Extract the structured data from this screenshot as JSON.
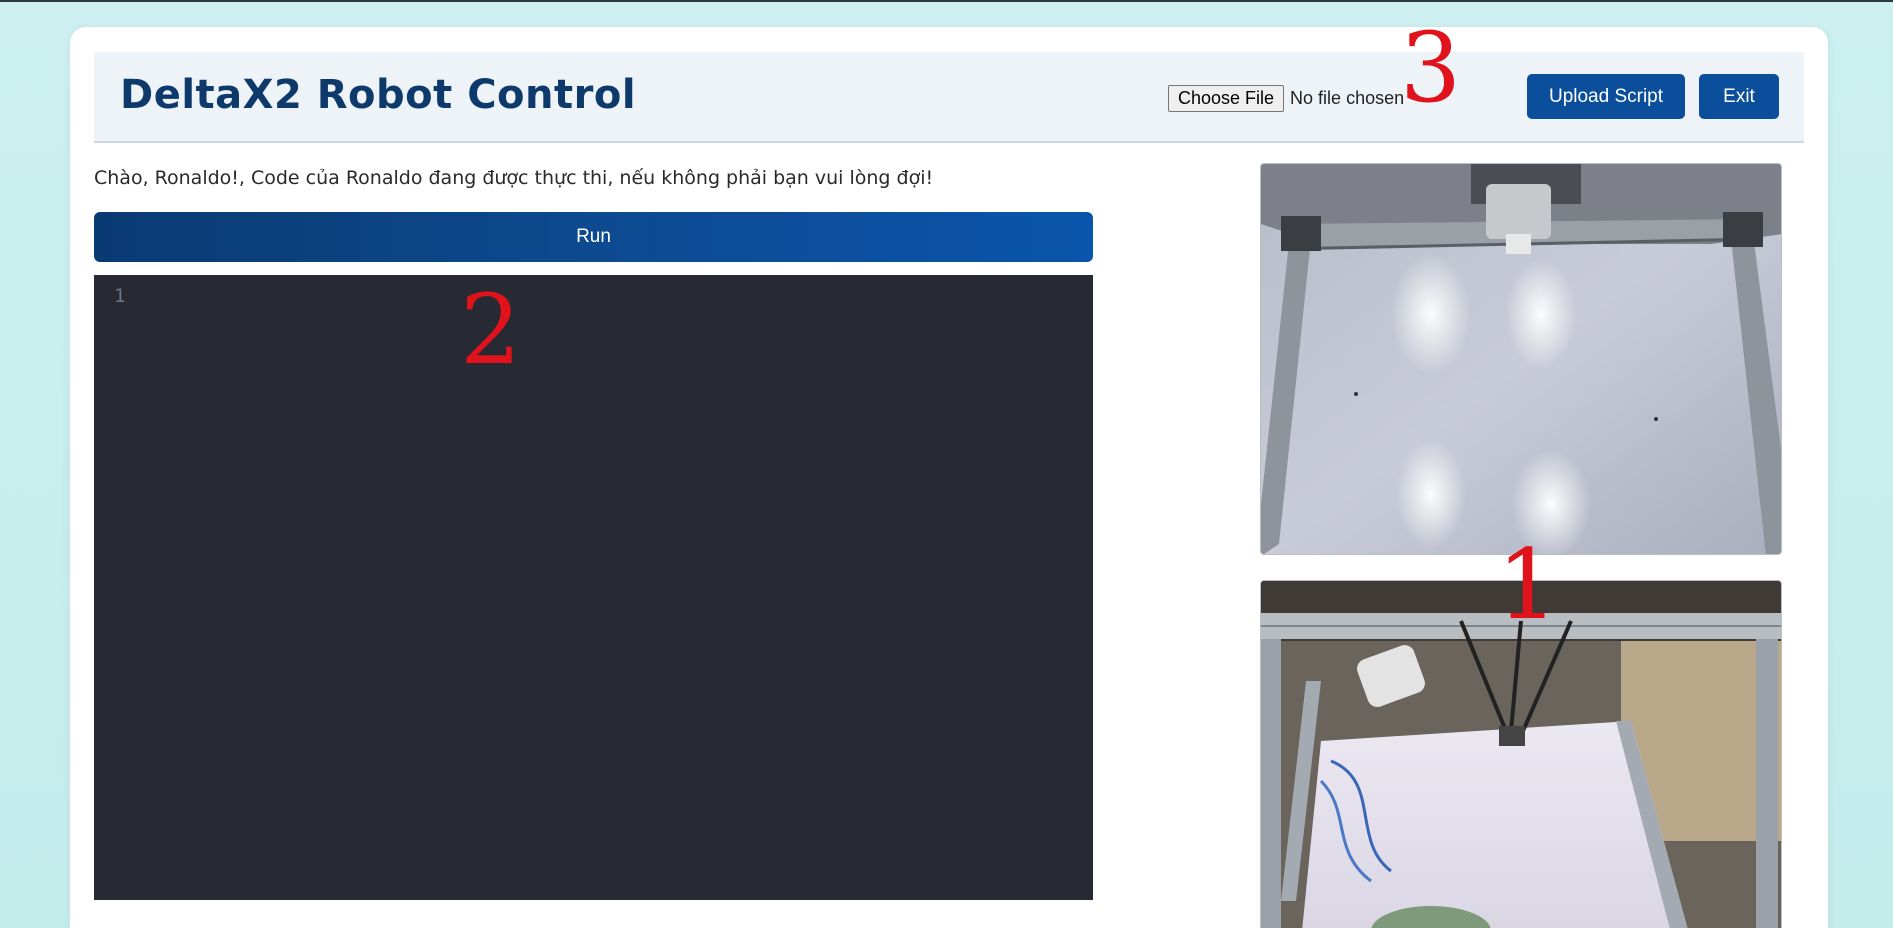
{
  "header": {
    "title": "DeltaX2 Robot Control",
    "choose_file_label": "Choose File",
    "no_file_text": "No file chosen",
    "upload_label": "Upload Script",
    "exit_label": "Exit"
  },
  "greeting": "Chào, Ronaldo!, Code của Ronaldo đang được thực thi, nếu không phải bạn vui lòng đợi!",
  "run_label": "Run",
  "editor": {
    "line_numbers": [
      "1"
    ]
  },
  "annotations": [
    "1",
    "2",
    "3"
  ],
  "cameras": [
    {
      "name": "camera-top-view"
    },
    {
      "name": "camera-side-view"
    }
  ],
  "colors": {
    "brand": "#0d3a6b",
    "button": "#0b4f9c",
    "editor_bg": "#272a33",
    "annotation": "#e0121b"
  }
}
